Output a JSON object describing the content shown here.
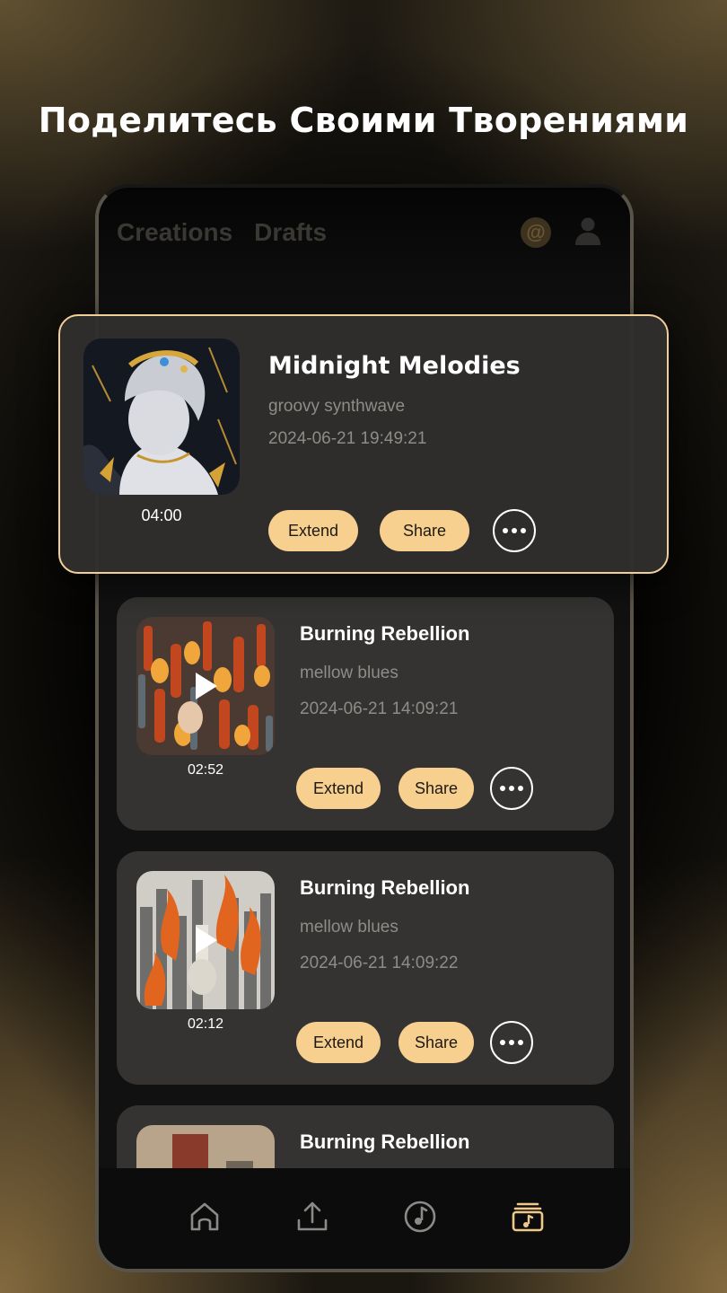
{
  "headline": "Поделитесь Своими Творениями",
  "header": {
    "tabs": [
      "Creations",
      "Drafts"
    ],
    "at_icon": "at-sign-icon",
    "profile_icon": "user-icon"
  },
  "featured": {
    "title": "Midnight Melodies",
    "genre": "groovy synthwave",
    "date": "2024-06-21  19:49:21",
    "duration": "04:00",
    "extend_label": "Extend",
    "share_label": "Share",
    "more_icon": "more-horizontal-icon"
  },
  "tracks": [
    {
      "title": "Burning Rebellion",
      "genre": "mellow blues",
      "date": "2024-06-21 14:09:21",
      "duration": "02:52",
      "extend_label": "Extend",
      "share_label": "Share"
    },
    {
      "title": "Burning Rebellion",
      "genre": "mellow blues",
      "date": "2024-06-21 14:09:22",
      "duration": "02:12",
      "extend_label": "Extend",
      "share_label": "Share"
    },
    {
      "title": "Burning Rebellion"
    }
  ],
  "nav": {
    "items": [
      "home-icon",
      "upload-icon",
      "music-note-icon",
      "library-icon"
    ],
    "active": "library-icon"
  },
  "colors": {
    "accent": "#f7cf8e",
    "card_bg": "#343331",
    "featured_border": "#f2cf97",
    "muted_text": "#8e8c88"
  }
}
